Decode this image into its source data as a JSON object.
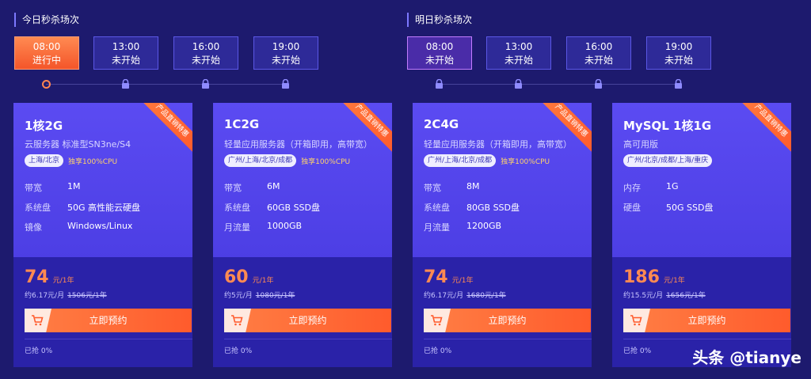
{
  "sessions": [
    {
      "title": "今日秒杀场次",
      "slots": [
        {
          "time": "08:00",
          "status": "进行中"
        },
        {
          "time": "13:00",
          "status": "未开始"
        },
        {
          "time": "16:00",
          "status": "未开始"
        },
        {
          "time": "19:00",
          "status": "未开始"
        }
      ]
    },
    {
      "title": "明日秒杀场次",
      "slots": [
        {
          "time": "08:00",
          "status": "未开始"
        },
        {
          "time": "13:00",
          "status": "未开始"
        },
        {
          "time": "16:00",
          "status": "未开始"
        },
        {
          "time": "19:00",
          "status": "未开始"
        }
      ]
    }
  ],
  "ribbon": "产品直销特惠",
  "cards": [
    {
      "title": "1核2G",
      "subtitle": "云服务器 标准型SN3ne/S4",
      "region": "上海/北京",
      "highlight": "独享100%CPU",
      "specs": [
        {
          "k": "带宽",
          "v": "1M"
        },
        {
          "k": "系统盘",
          "v": "50G 高性能云硬盘"
        },
        {
          "k": "镜像",
          "v": "Windows/Linux"
        }
      ],
      "price": "74",
      "price_unit": "元/1年",
      "monthly": "约6.17元/月",
      "original": "1506元/1年",
      "button": "立即预约",
      "sold": "已抢 0%"
    },
    {
      "title": "1C2G",
      "subtitle": "轻量应用服务器（开箱即用，高带宽）",
      "region": "广州/上海/北京/成都",
      "highlight": "独享100%CPU",
      "specs": [
        {
          "k": "带宽",
          "v": "6M"
        },
        {
          "k": "系统盘",
          "v": "60GB SSD盘"
        },
        {
          "k": "月流量",
          "v": "1000GB"
        }
      ],
      "price": "60",
      "price_unit": "元/1年",
      "monthly": "约5元/月",
      "original": "1080元/1年",
      "button": "立即预约",
      "sold": "已抢 0%"
    },
    {
      "title": "2C4G",
      "subtitle": "轻量应用服务器（开箱即用，高带宽）",
      "region": "广州/上海/北京/成都",
      "highlight": "独享100%CPU",
      "specs": [
        {
          "k": "带宽",
          "v": "8M"
        },
        {
          "k": "系统盘",
          "v": "80GB SSD盘"
        },
        {
          "k": "月流量",
          "v": "1200GB"
        }
      ],
      "price": "74",
      "price_unit": "元/1年",
      "monthly": "约6.17元/月",
      "original": "1680元/1年",
      "button": "立即预约",
      "sold": "已抢 0%"
    },
    {
      "title": "MySQL 1核1G",
      "subtitle": "高可用版",
      "region": "广州/北京/成都/上海/重庆",
      "highlight": "",
      "specs": [
        {
          "k": "内存",
          "v": "1G"
        },
        {
          "k": "硬盘",
          "v": "50G SSD盘"
        }
      ],
      "price": "186",
      "price_unit": "元/1年",
      "monthly": "约15.5元/月",
      "original": "1656元/1年",
      "button": "立即预约",
      "sold": "已抢 0%"
    }
  ],
  "watermark": "头条 @tianye",
  "colors": {
    "background": "#1d1a6e",
    "accent": "#ff5b2c",
    "card": "#5b4bf2"
  }
}
